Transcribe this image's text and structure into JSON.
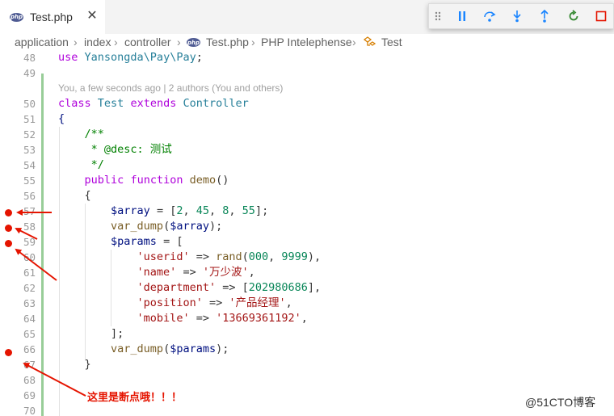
{
  "tab": {
    "label": "Test.php",
    "close": "✕",
    "icon_text": "php"
  },
  "debug_toolbar": [
    "drag-handle",
    "pause",
    "step-over",
    "step-into",
    "step-out",
    "restart",
    "stop"
  ],
  "breadcrumb": [
    "application",
    "index",
    "controller",
    "Test.php",
    "PHP Intelephense",
    "Test"
  ],
  "blame": "You, a few seconds ago | 2 authors (You and others)",
  "lines": [
    {
      "n": "48",
      "code": "use Yansongda\\Pay\\Pay;"
    },
    {
      "n": "49",
      "code": ""
    },
    {
      "n": "50",
      "code": "class Test extends Controller"
    },
    {
      "n": "51",
      "code": "{"
    },
    {
      "n": "52",
      "code": "    /**"
    },
    {
      "n": "53",
      "code": "     * @desc: 测试"
    },
    {
      "n": "54",
      "code": "     */"
    },
    {
      "n": "55",
      "code": "    public function demo()"
    },
    {
      "n": "56",
      "code": "    {"
    },
    {
      "n": "57",
      "code": "        $array = [2, 45, 8, 55];"
    },
    {
      "n": "58",
      "code": "        var_dump($array);"
    },
    {
      "n": "59",
      "code": "        $params = ["
    },
    {
      "n": "60",
      "code": "            'userid' => rand(000, 9999),"
    },
    {
      "n": "61",
      "code": "            'name' => '万少波',"
    },
    {
      "n": "62",
      "code": "            'department' => [202980686],"
    },
    {
      "n": "63",
      "code": "            'position' => '产品经理',"
    },
    {
      "n": "64",
      "code": "            'mobile' => '13669361192',"
    },
    {
      "n": "65",
      "code": "        ];"
    },
    {
      "n": "66",
      "code": "        var_dump($params);"
    },
    {
      "n": "67",
      "code": "    }"
    },
    {
      "n": "68",
      "code": ""
    },
    {
      "n": "69",
      "code": ""
    },
    {
      "n": "70",
      "code": ""
    }
  ],
  "annotation": "这里是断点哦！！！",
  "watermark": "@51CTO博客",
  "colors": {
    "breakpoint": "#e51400",
    "keyword": "#af00db",
    "string": "#a31515",
    "number": "#098658"
  }
}
